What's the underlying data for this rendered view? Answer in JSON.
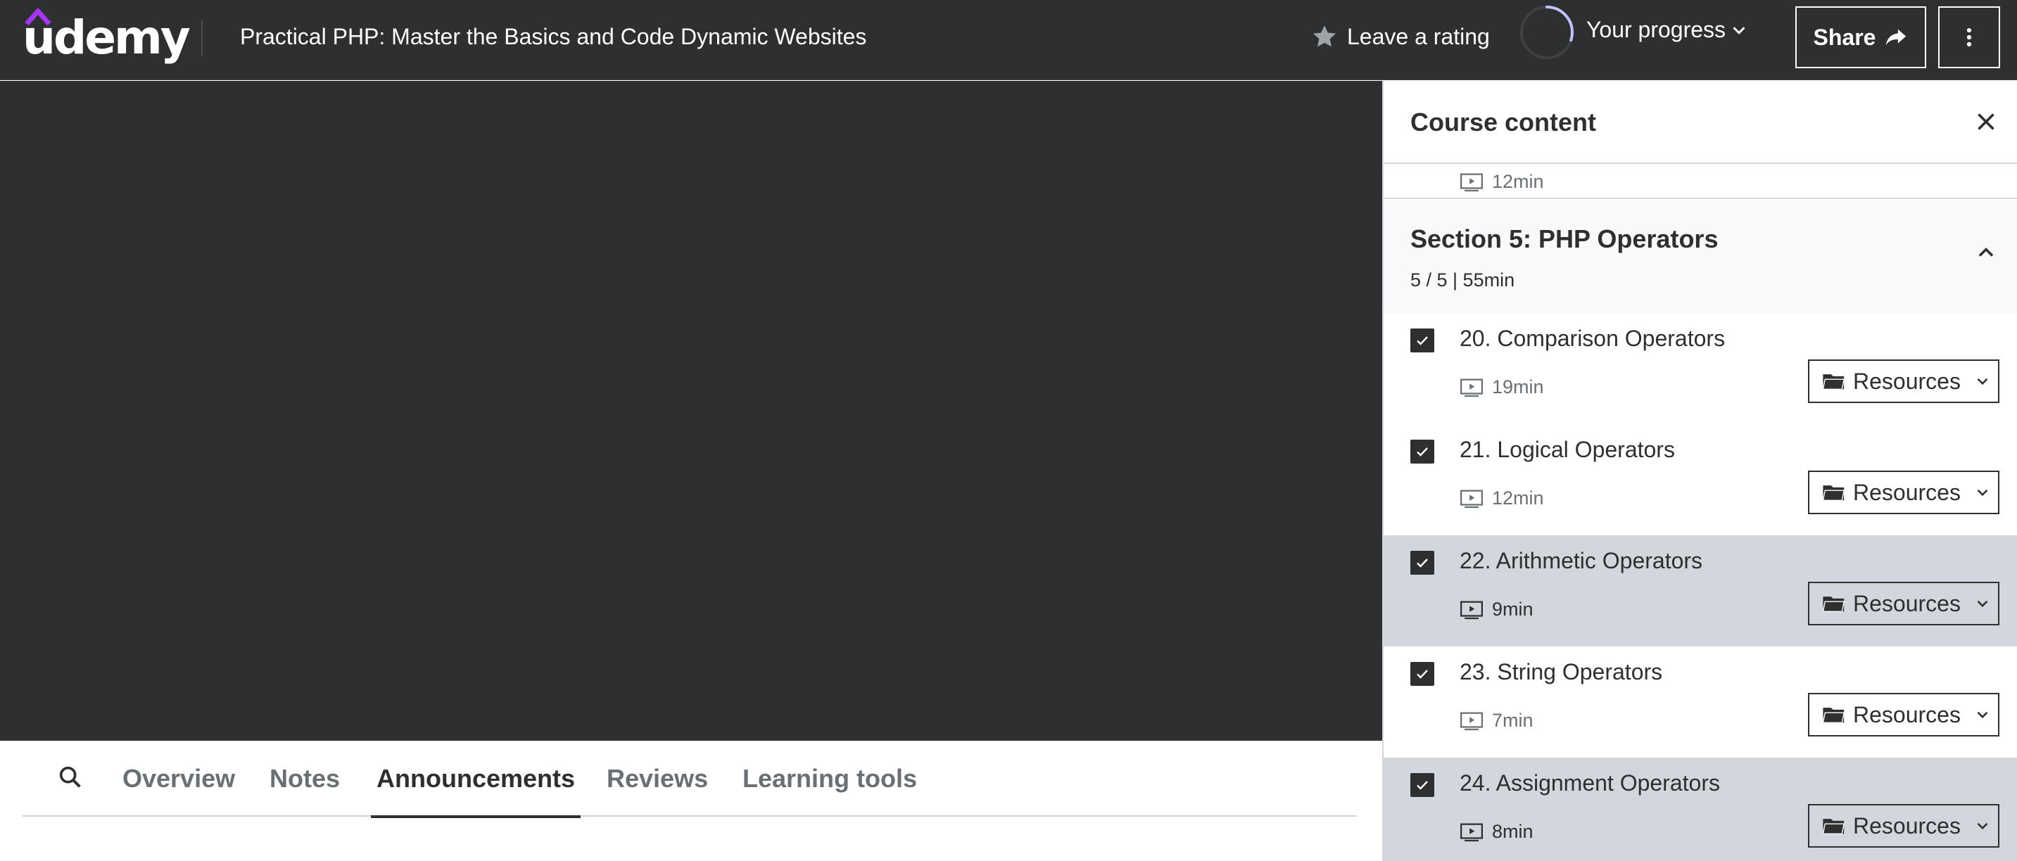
{
  "header": {
    "logo_text": "udemy",
    "course_title": "Practical PHP: Master the Basics and Code Dynamic Websites",
    "rating_label": "Leave a rating",
    "progress_label": "Your progress",
    "progress_fraction": 0.3,
    "share_label": "Share"
  },
  "tabs": [
    {
      "label": "Overview",
      "active": false
    },
    {
      "label": "Notes",
      "active": false
    },
    {
      "label": "Announcements",
      "active": true
    },
    {
      "label": "Reviews",
      "active": false
    },
    {
      "label": "Learning tools",
      "active": false
    }
  ],
  "sidebar": {
    "title": "Course content",
    "previous_item_duration": "12min",
    "section": {
      "title": "Section 5: PHP Operators",
      "meta": "5 / 5 | 55min"
    },
    "lectures": [
      {
        "title": "20. Comparison Operators",
        "duration": "19min",
        "resources_label": "Resources",
        "completed": true,
        "highlighted": false
      },
      {
        "title": "21. Logical Operators",
        "duration": "12min",
        "resources_label": "Resources",
        "completed": true,
        "highlighted": false
      },
      {
        "title": "22. Arithmetic Operators",
        "duration": "9min",
        "resources_label": "Resources",
        "completed": true,
        "highlighted": true
      },
      {
        "title": "23. String Operators",
        "duration": "7min",
        "resources_label": "Resources",
        "completed": true,
        "highlighted": false
      },
      {
        "title": "24. Assignment Operators",
        "duration": "8min",
        "resources_label": "Resources",
        "completed": true,
        "highlighted": true
      }
    ]
  },
  "colors": {
    "header_bg": "#2d2f31",
    "brand_purple": "#a435f0",
    "progress_ring": "#c0c4fc",
    "highlight_row": "#d1d7dc"
  }
}
